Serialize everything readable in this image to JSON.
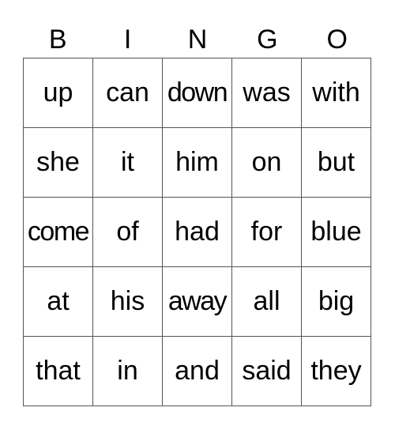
{
  "header": [
    "B",
    "I",
    "N",
    "G",
    "O"
  ],
  "rows": [
    [
      "up",
      "can",
      "down",
      "was",
      "with"
    ],
    [
      "she",
      "it",
      "him",
      "on",
      "but"
    ],
    [
      "come",
      "of",
      "had",
      "for",
      "blue"
    ],
    [
      "at",
      "his",
      "away",
      "all",
      "big"
    ],
    [
      "that",
      "in",
      "and",
      "said",
      "they"
    ]
  ]
}
